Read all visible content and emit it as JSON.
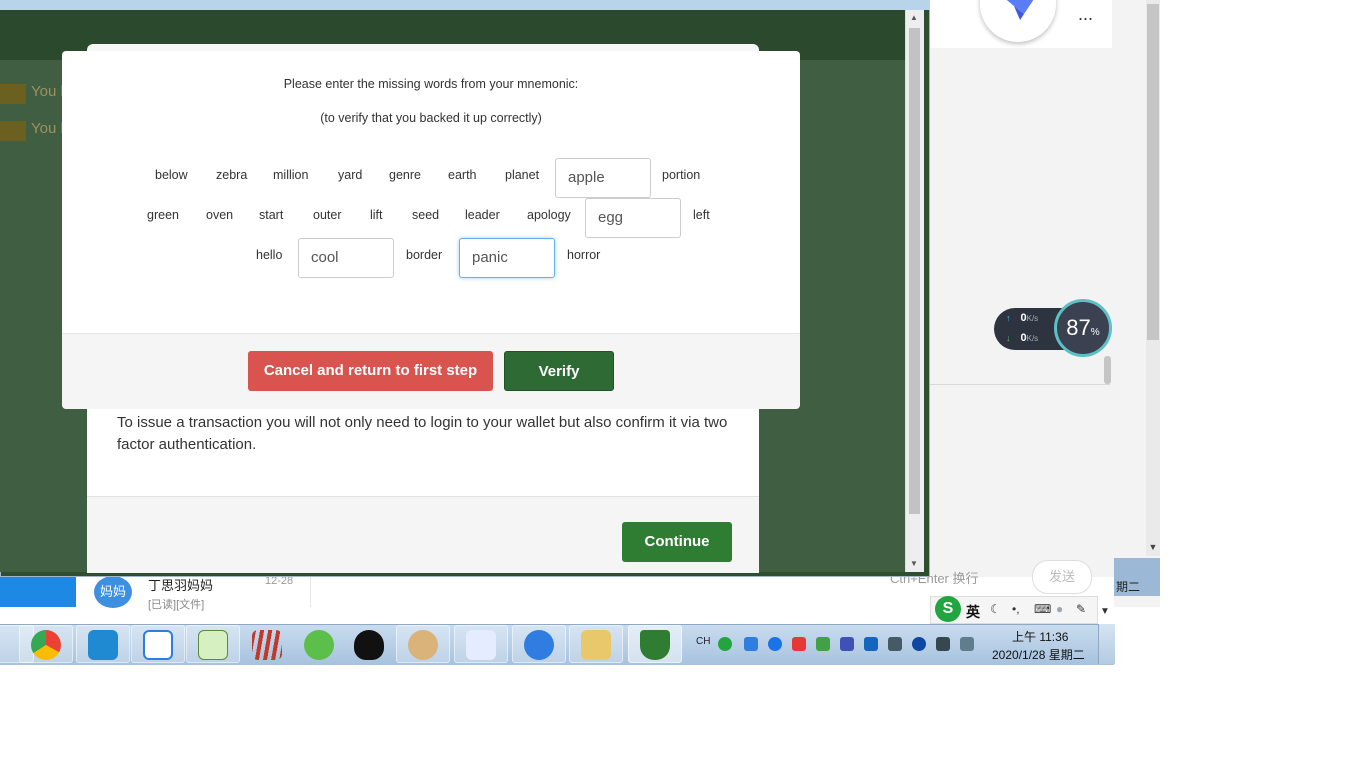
{
  "modal": {
    "title": "Please enter the missing words from your mnemonic:",
    "subtitle": "(to verify that you backed it up correctly)",
    "row1": {
      "w1": "below",
      "w2": "zebra",
      "w3": "million",
      "w4": "yard",
      "w5": "genre",
      "w6": "earth",
      "w7": "planet",
      "input1": "apple",
      "w8": "portion"
    },
    "row2": {
      "w1": "green",
      "w2": "oven",
      "w3": "start",
      "w4": "outer",
      "w5": "lift",
      "w6": "seed",
      "w7": "leader",
      "w8": "apology",
      "input1": "egg",
      "w9": "left"
    },
    "row3": {
      "w1": "hello",
      "input1": "cool",
      "w2": "border",
      "input2": "panic",
      "w3": "horror"
    },
    "cancel_label": "Cancel and return to first step",
    "verify_label": "Verify"
  },
  "background_page": {
    "badge1_text": "You l",
    "badge2_text": "You l",
    "card_text": "To issue a transaction you will not only need to login to your wallet but also confirm it via two factor authentication.",
    "continue_label": "Continue"
  },
  "chat_app": {
    "more_label": "...",
    "speed_up": "0",
    "speed_down": "0",
    "speed_unit": "K/s",
    "cpu_percent": "87",
    "cpu_unit": "%",
    "preview_avatar": "妈妈",
    "preview_name": "丁思羽妈妈",
    "preview_date": "12-28",
    "preview_sub": "[已读][文件]",
    "send_hint": "Ctrl+Enter 换行",
    "send_label": "发送",
    "side_panel_text": "期二"
  },
  "ime": {
    "logo": "S",
    "lang": "英"
  },
  "taskbar": {
    "tray_lang": "CH",
    "clock_time": "上午 11:36",
    "clock_date": "2020/1/28 星期二"
  },
  "colors": {
    "cancel": "#d9534f",
    "verify": "#2e6b34",
    "continue": "#2e7d32",
    "page_bg": "#3f5e42"
  }
}
